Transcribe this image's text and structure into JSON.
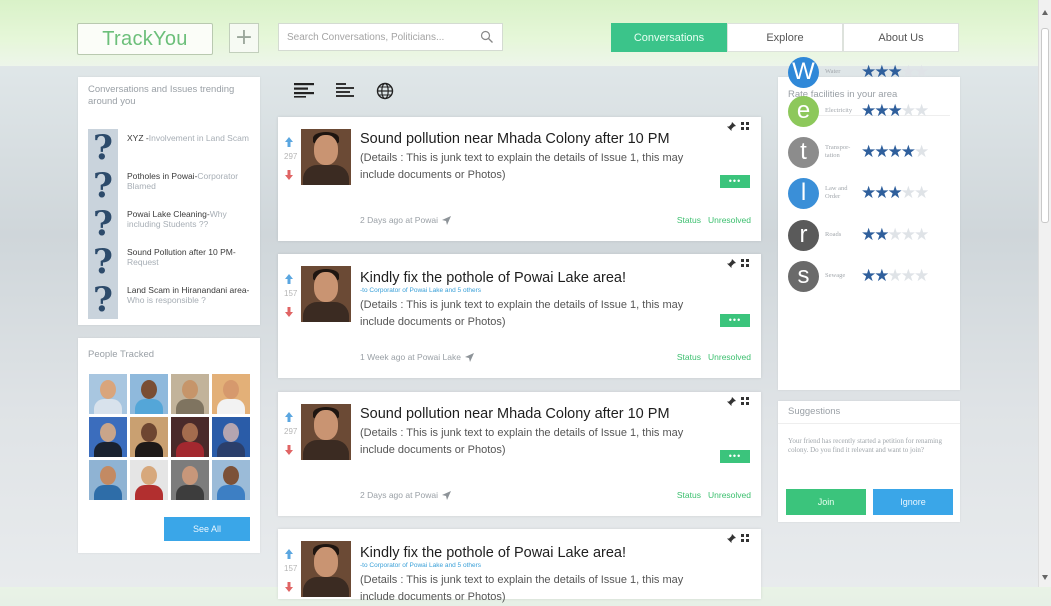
{
  "app": {
    "logo": "TrackYou",
    "add_label": "+"
  },
  "search": {
    "placeholder": "Search Conversations, Politicians..."
  },
  "nav": [
    {
      "label": "Conversations",
      "active": true
    },
    {
      "label": "Explore",
      "active": false
    },
    {
      "label": "About Us",
      "active": false
    }
  ],
  "trending": {
    "title": "Conversations and Issues trending around you",
    "items": [
      {
        "title": "XYZ -",
        "subtitle": "Involvement in Land Scam"
      },
      {
        "title": "Potholes in Powai-",
        "subtitle": "Corporator Blamed"
      },
      {
        "title": "Powai Lake Cleaning-",
        "subtitle": "Why including Students ??"
      },
      {
        "title": "Sound Pollution after 10 PM-",
        "subtitle": "Request"
      },
      {
        "title": "Land Scam in Hiranandani area-",
        "subtitle": "Who is responsible ?"
      }
    ]
  },
  "people": {
    "title": "People Tracked",
    "see_all": "See All",
    "faces": [
      {
        "skin": "#d9a57c",
        "shirt": "#d8e2ec",
        "bg": "#a8c6e0"
      },
      {
        "skin": "#7a4e34",
        "shirt": "#54a6d8",
        "bg": "#8fb9dc"
      },
      {
        "skin": "#c6956a",
        "shirt": "#7f7460",
        "bg": "#c2b39a"
      },
      {
        "skin": "#d6996d",
        "shirt": "#f2f2f2",
        "bg": "#e3b078"
      },
      {
        "skin": "#c9a58a",
        "shirt": "#1a2230",
        "bg": "#3b6dbd"
      },
      {
        "skin": "#6e4631",
        "shirt": "#1e1a18",
        "bg": "#c9a071"
      },
      {
        "skin": "#a46c4e",
        "shirt": "#a3282f",
        "bg": "#4a2a2a"
      },
      {
        "skin": "#b4a5b0",
        "shirt": "#2b3f6b",
        "bg": "#2a5ca8"
      },
      {
        "skin": "#c38a63",
        "shirt": "#2e6da8",
        "bg": "#8fb3d3"
      },
      {
        "skin": "#d7a87c",
        "shirt": "#b22f2f",
        "bg": "#e5e5e5"
      },
      {
        "skin": "#c8977a",
        "shirt": "#3d3d3d",
        "bg": "#7c7c7c"
      },
      {
        "skin": "#7c5138",
        "shirt": "#3d7fc4",
        "bg": "#9bbbd8"
      }
    ]
  },
  "feed": [
    {
      "title": "Sound pollution near Mhada Colony after 10 PM",
      "sub": "",
      "details": "(Details : This is junk text to explain the details of Issue 1, this may include documents or Photos)",
      "votes": "297",
      "meta": "2 Days ago at Powai",
      "status_label": "Status",
      "status_value": "Unresolved",
      "more": "•••"
    },
    {
      "title": "Kindly fix the pothole of Powai Lake area!",
      "sub": "-to Corporator of Powai Lake and 5 others",
      "details": "(Details : This is junk text to explain the details of Issue 1, this may include documents or Photos)",
      "votes": "157",
      "meta": "1 Week ago at Powai Lake",
      "status_label": "Status",
      "status_value": "Unresolved",
      "more": "•••"
    },
    {
      "title": "Sound pollution near Mhada Colony after 10 PM",
      "sub": "",
      "details": "(Details : This is junk text to explain the details of Issue 1, this may include documents or Photos)",
      "votes": "297",
      "meta": "2 Days ago at Powai",
      "status_label": "Status",
      "status_value": "Unresolved",
      "more": "•••"
    },
    {
      "title": "Kindly fix the pothole of Powai Lake area!",
      "sub": "-to Corporator of Powai Lake and 5 others",
      "details": "(Details : This is junk text to explain the details of Issue 1, this may include documents or Photos)",
      "votes": "157",
      "meta": "",
      "status_label": "",
      "status_value": "",
      "more": ""
    }
  ],
  "rate": {
    "title": "Rate facilities in your area",
    "items": [
      {
        "letter": "W",
        "label": "Water",
        "color": "#2f88d8",
        "rating": 3
      },
      {
        "letter": "e",
        "label": "Electricity",
        "color": "#8dc85b",
        "rating": 3
      },
      {
        "letter": "t",
        "label": "Transpor-tation",
        "color": "#8c8c8c",
        "rating": 4
      },
      {
        "letter": "l",
        "label": "Law and Order",
        "color": "#3a8fd8",
        "rating": 3
      },
      {
        "letter": "r",
        "label": "Roads",
        "color": "#5a5a5a",
        "rating": 2
      },
      {
        "letter": "s",
        "label": "Sewage",
        "color": "#6a6a6a",
        "rating": 2
      }
    ],
    "max_rating": 5
  },
  "suggestions": {
    "title": "Suggestions",
    "text": "Your friend has recently started a petition for renaming colony. Do you find it relevant and want to join?",
    "join": "Join",
    "ignore": "Ignore"
  },
  "colors": {
    "accent_green": "#3bc47c",
    "accent_blue": "#3aa6e8",
    "nav_active": "#3bc48a"
  }
}
